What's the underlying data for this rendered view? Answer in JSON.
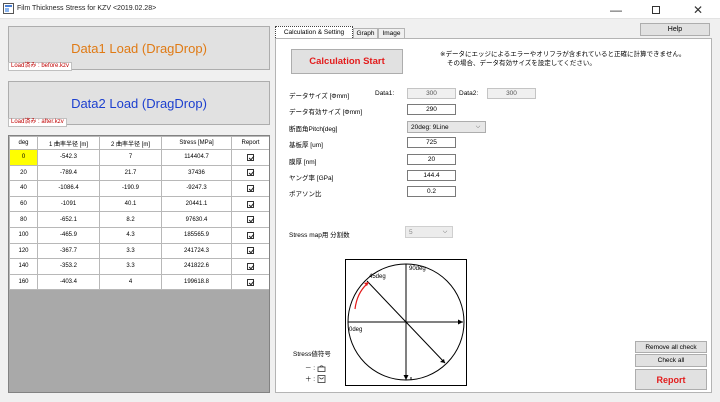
{
  "window": {
    "title": "Film Thickness Stress for KZV",
    "version": "<2019.02.28>",
    "minimize": "—",
    "close": "✕"
  },
  "loads": {
    "data1_button": "Data1 Load (DragDrop)",
    "data1_file": "Load済み : before.kzv",
    "data2_button": "Data2 Load (DragDrop)",
    "data2_file": "Load済み : after.kzv"
  },
  "table": {
    "columns": [
      "deg",
      "1 曲率半径 [m]",
      "2 曲率半径 [m]",
      "Stress [MPa]",
      "Report"
    ],
    "rows": [
      [
        "0",
        "-542.3",
        "7",
        "114404.7",
        true
      ],
      [
        "20",
        "-789.4",
        "21.7",
        "37436",
        true
      ],
      [
        "40",
        "-1086.4",
        "-190.9",
        "-9247.3",
        true
      ],
      [
        "60",
        "-1091",
        "40.1",
        "20441.1",
        true
      ],
      [
        "80",
        "-652.1",
        "8.2",
        "97630.4",
        true
      ],
      [
        "100",
        "-465.9",
        "4.3",
        "185565.9",
        true
      ],
      [
        "120",
        "-367.7",
        "3.3",
        "241724.3",
        true
      ],
      [
        "140",
        "-353.2",
        "3.3",
        "241822.6",
        true
      ],
      [
        "160",
        "-403.4",
        "4",
        "199618.8",
        true
      ]
    ]
  },
  "help_button": "Help",
  "tabs": [
    "Calculation & Setting",
    "Graph",
    "Image"
  ],
  "calc": {
    "start_button": "Calculation Start",
    "warning_line1": "※データにエッジによるエラーやオリフラが含まれていると正確に計算できません。",
    "warning_line2": "その場合、データ有効サイズを設定してください。",
    "data_size_label": "データサイズ [Φmm]",
    "data1_label": "Data1:",
    "data1_value": "300",
    "data2_label": "Data2:",
    "data2_value": "300",
    "valid_size_label": "データ有効サイズ [Φmm]",
    "valid_size_value": "290",
    "pitch_label": "断面角Pitch[deg]",
    "pitch_value": "20deg: 9Line",
    "substrate_label": "基板厚 [um]",
    "substrate_value": "725",
    "film_label": "膜厚 [nm]",
    "film_value": "20",
    "young_label": "ヤング率 [GPa]",
    "young_value": "144.4",
    "poisson_label": "ポアソン比",
    "poisson_value": "0.2",
    "stressmap_label": "Stress map用 分割数",
    "stressmap_value": "5"
  },
  "diagram": {
    "label_45": "45deg",
    "label_90": "90deg",
    "label_0": "0deg"
  },
  "sign": {
    "title": "Stress値符号",
    "minus_label": "－ :",
    "plus_label": "＋ :"
  },
  "buttons": {
    "remove_all": "Remove all check",
    "check_all": "Check all",
    "report": "Report"
  }
}
